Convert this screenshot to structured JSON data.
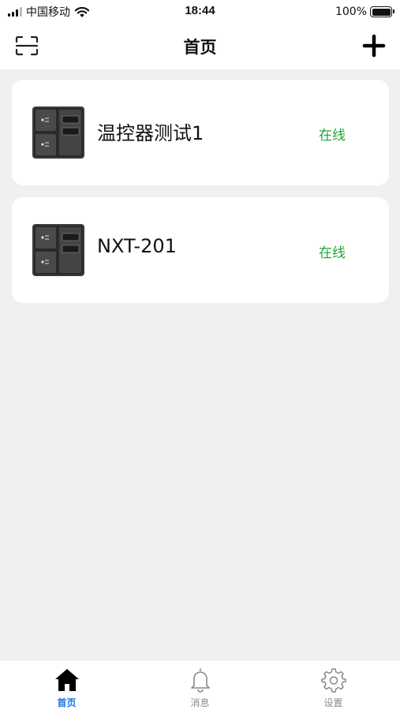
{
  "status_bar": {
    "carrier": "中国移动",
    "time": "18:44",
    "battery": "100%"
  },
  "nav": {
    "title": "首页",
    "left_icon": "scan-icon",
    "right_icon": "plus-icon"
  },
  "devices": [
    {
      "name": "温控器测试1",
      "status": "在线",
      "icon": "thermostat-device-icon"
    },
    {
      "name": "NXT-201",
      "status": "在线",
      "icon": "thermostat-device-icon"
    }
  ],
  "colors": {
    "online": "#22a43c",
    "active_tab": "#1a73e8",
    "inactive_tab": "#8a8a8a",
    "background": "#f0f0f0"
  },
  "tabs": [
    {
      "label": "首页",
      "icon": "home-icon",
      "active": true
    },
    {
      "label": "消息",
      "icon": "bell-icon",
      "active": false
    },
    {
      "label": "设置",
      "icon": "gear-icon",
      "active": false
    }
  ]
}
